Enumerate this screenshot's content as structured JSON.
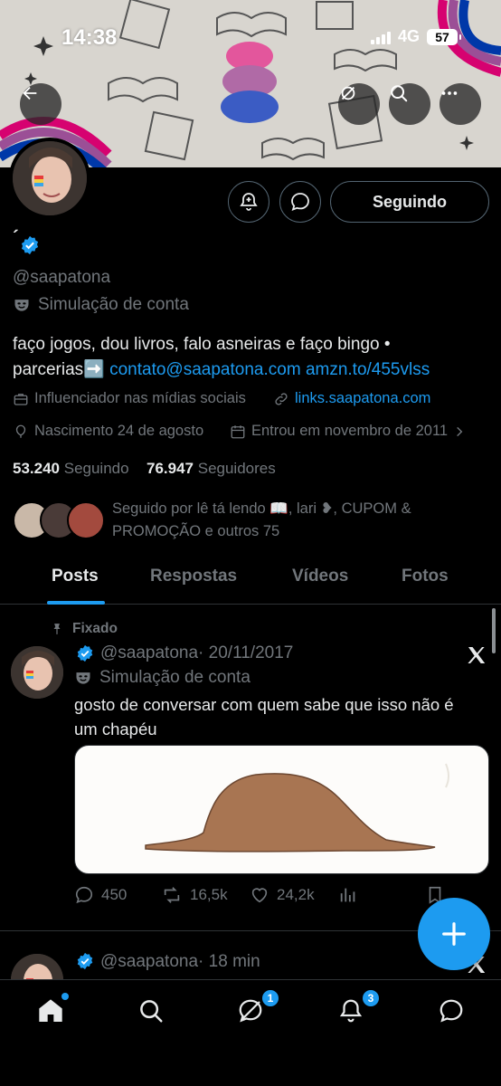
{
  "status_bar": {
    "time": "14:38",
    "network": "4G",
    "battery": "57"
  },
  "profile": {
    "display_name": "´",
    "handle": "@saapatona",
    "label": "Simulação de conta",
    "bio_line1": "faço jogos, dou livros, falo asneiras e faço bingo •",
    "bio_line2_prefix": "parcerias",
    "bio_arrow": "➡️",
    "bio_email": "contato@saapatona.com",
    "bio_link": "amzn.to/455vlss",
    "category": "Influenciador nas mídias sociais",
    "website": "links.saapatona.com",
    "birthday": "Nascimento 24 de agosto",
    "joined": "Entrou em novembro de 2011",
    "following_count": "53.240",
    "following_label": "Seguindo",
    "followers_count": "76.947",
    "followers_label": "Seguidores",
    "followed_by_line1": "Seguido por lê tá lendo 📖, lari ❥, CUPOM &",
    "followed_by_line2": "PROMOÇÃO e outros 75",
    "follow_button": "Seguindo"
  },
  "tabs": [
    {
      "label": "Posts"
    },
    {
      "label": "Respostas"
    },
    {
      "label": "Vídeos"
    },
    {
      "label": "Fotos"
    }
  ],
  "posts": [
    {
      "pinned_label": "Fixado",
      "handle": "@saapatona",
      "date": "· 20/11/2017",
      "label": "Simulação de conta",
      "text_line1": "gosto de conversar com quem sabe que isso não é",
      "text_line2": "um chapéu",
      "replies": "450",
      "reposts": "16,5k",
      "likes": "24,2k"
    },
    {
      "handle": "@saapatona",
      "date": "· 18 min"
    }
  ],
  "nav_badges": {
    "messages": "1",
    "notifications": "3"
  },
  "colors": {
    "accent": "#1d9bf0",
    "background": "#000000",
    "muted": "#71767b"
  }
}
